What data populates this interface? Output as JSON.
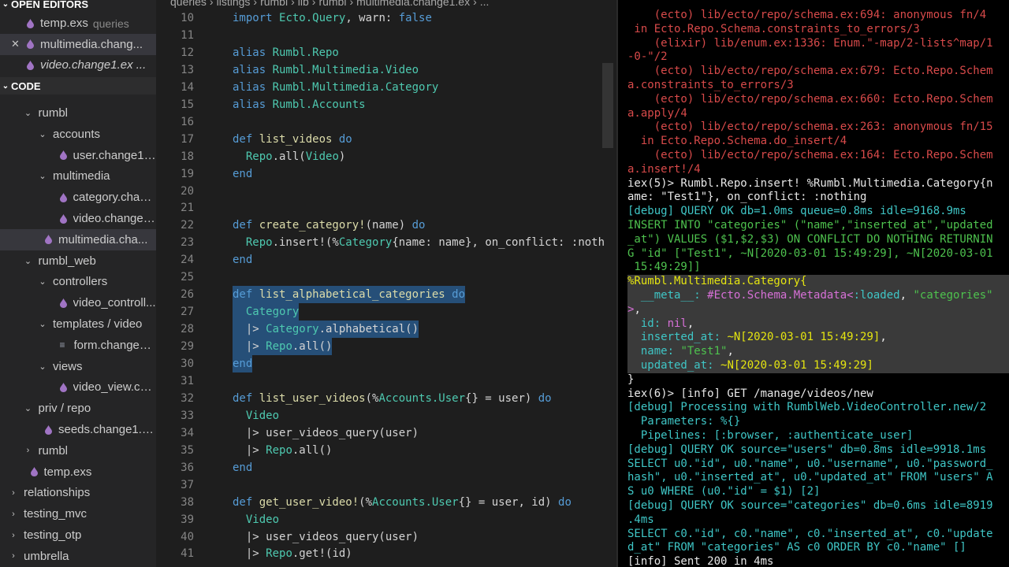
{
  "sidebar": {
    "open_editors_title": "OPEN EDITORS",
    "code_title": "CODE",
    "open_editors": [
      {
        "label": "temp.exs",
        "extra": "queries",
        "italic": false,
        "active": false,
        "closable": false
      },
      {
        "label": "multimedia.chang...",
        "extra": "",
        "italic": false,
        "active": true,
        "closable": true
      },
      {
        "label": "video.change1.ex ...",
        "extra": "",
        "italic": true,
        "active": false,
        "closable": false
      }
    ],
    "tree": [
      {
        "label": "rumbl",
        "type": "folder",
        "indent": 1,
        "open": true
      },
      {
        "label": "accounts",
        "type": "folder",
        "indent": 2,
        "open": true
      },
      {
        "label": "user.change1.ex",
        "type": "file",
        "indent": 3
      },
      {
        "label": "multimedia",
        "type": "folder",
        "indent": 2,
        "open": true
      },
      {
        "label": "category.chan...",
        "type": "file",
        "indent": 3
      },
      {
        "label": "video.change1...",
        "type": "file",
        "indent": 3
      },
      {
        "label": "multimedia.cha...",
        "type": "file",
        "indent": 2,
        "active": true
      },
      {
        "label": "rumbl_web",
        "type": "folder",
        "indent": 1,
        "open": true
      },
      {
        "label": "controllers",
        "type": "folder",
        "indent": 2,
        "open": true
      },
      {
        "label": "video_controll...",
        "type": "file",
        "indent": 3
      },
      {
        "label": "templates / video",
        "type": "folder",
        "indent": 2,
        "open": true
      },
      {
        "label": "form.change1....",
        "type": "plain",
        "indent": 3
      },
      {
        "label": "views",
        "type": "folder",
        "indent": 2,
        "open": true
      },
      {
        "label": "video_view.cha...",
        "type": "file",
        "indent": 3
      },
      {
        "label": "priv / repo",
        "type": "folder",
        "indent": 1,
        "open": true
      },
      {
        "label": "seeds.change1.exs",
        "type": "file",
        "indent": 2
      },
      {
        "label": "rumbl",
        "type": "folder",
        "indent": 1,
        "open": false
      },
      {
        "label": "temp.exs",
        "type": "file",
        "indent": 1
      },
      {
        "label": "relationships",
        "type": "folder",
        "indent": 0,
        "open": false
      },
      {
        "label": "testing_mvc",
        "type": "folder",
        "indent": 0,
        "open": false
      },
      {
        "label": "testing_otp",
        "type": "folder",
        "indent": 0,
        "open": false
      },
      {
        "label": "umbrella",
        "type": "folder",
        "indent": 0,
        "open": false
      }
    ]
  },
  "breadcrumb": [
    "queries",
    "›",
    "listings",
    "›",
    "rumbl",
    "›",
    "lib",
    "›",
    "rumbl",
    "›",
    "multimedia.change1.ex",
    "›",
    "..."
  ],
  "editor": {
    "lines": [
      {
        "n": "10",
        "tokens": [
          [
            "k",
            "import "
          ],
          [
            "t",
            "Ecto.Query"
          ],
          [
            "p",
            ", warn: "
          ],
          [
            "k",
            "false"
          ]
        ]
      },
      {
        "n": "11",
        "tokens": []
      },
      {
        "n": "12",
        "tokens": [
          [
            "k",
            "alias "
          ],
          [
            "t",
            "Rumbl.Repo"
          ]
        ]
      },
      {
        "n": "13",
        "tokens": [
          [
            "k",
            "alias "
          ],
          [
            "t",
            "Rumbl.Multimedia.Video"
          ]
        ]
      },
      {
        "n": "14",
        "tokens": [
          [
            "k",
            "alias "
          ],
          [
            "t",
            "Rumbl.Multimedia.Category"
          ]
        ]
      },
      {
        "n": "15",
        "tokens": [
          [
            "k",
            "alias "
          ],
          [
            "t",
            "Rumbl.Accounts"
          ]
        ]
      },
      {
        "n": "16",
        "tokens": []
      },
      {
        "n": "17",
        "tokens": [
          [
            "k",
            "def "
          ],
          [
            "f",
            "list_videos "
          ],
          [
            "k",
            "do"
          ]
        ]
      },
      {
        "n": "18",
        "tokens": [
          [
            "p",
            "  "
          ],
          [
            "t",
            "Repo"
          ],
          [
            "p",
            ".all("
          ],
          [
            "t",
            "Video"
          ],
          [
            "p",
            ")"
          ]
        ]
      },
      {
        "n": "19",
        "tokens": [
          [
            "k",
            "end"
          ]
        ]
      },
      {
        "n": "20",
        "tokens": []
      },
      {
        "n": "21",
        "tokens": []
      },
      {
        "n": "22",
        "tokens": [
          [
            "k",
            "def "
          ],
          [
            "f",
            "create_category!"
          ],
          [
            "p",
            "(name) "
          ],
          [
            "k",
            "do"
          ]
        ]
      },
      {
        "n": "23",
        "tokens": [
          [
            "p",
            "  "
          ],
          [
            "t",
            "Repo"
          ],
          [
            "p",
            ".insert!(%"
          ],
          [
            "t",
            "Category"
          ],
          [
            "p",
            "{name: name}, on_conflict: :noth"
          ]
        ]
      },
      {
        "n": "24",
        "tokens": [
          [
            "k",
            "end"
          ]
        ]
      },
      {
        "n": "25",
        "tokens": []
      },
      {
        "n": "26",
        "sel": true,
        "tokens": [
          [
            "k",
            "def "
          ],
          [
            "f",
            "list_alphabetical_categories "
          ],
          [
            "k",
            "do"
          ]
        ]
      },
      {
        "n": "27",
        "sel": true,
        "tokens": [
          [
            "p",
            "  "
          ],
          [
            "t",
            "Category"
          ]
        ]
      },
      {
        "n": "28",
        "sel": true,
        "tokens": [
          [
            "p",
            "  |> "
          ],
          [
            "t",
            "Category"
          ],
          [
            "p",
            ".alphabetical()"
          ]
        ]
      },
      {
        "n": "29",
        "sel": true,
        "tokens": [
          [
            "p",
            "  |> "
          ],
          [
            "t",
            "Repo"
          ],
          [
            "p",
            ".all()"
          ]
        ]
      },
      {
        "n": "30",
        "sel": true,
        "tokens": [
          [
            "k",
            "end"
          ]
        ]
      },
      {
        "n": "31",
        "tokens": []
      },
      {
        "n": "32",
        "tokens": [
          [
            "k",
            "def "
          ],
          [
            "f",
            "list_user_videos"
          ],
          [
            "p",
            "(%"
          ],
          [
            "t",
            "Accounts.User"
          ],
          [
            "p",
            "{} = user) "
          ],
          [
            "k",
            "do"
          ]
        ]
      },
      {
        "n": "33",
        "tokens": [
          [
            "p",
            "  "
          ],
          [
            "t",
            "Video"
          ]
        ]
      },
      {
        "n": "34",
        "tokens": [
          [
            "p",
            "  |> user_videos_query(user)"
          ]
        ]
      },
      {
        "n": "35",
        "tokens": [
          [
            "p",
            "  |> "
          ],
          [
            "t",
            "Repo"
          ],
          [
            "p",
            ".all()"
          ]
        ]
      },
      {
        "n": "36",
        "tokens": [
          [
            "k",
            "end"
          ]
        ]
      },
      {
        "n": "37",
        "tokens": []
      },
      {
        "n": "38",
        "tokens": [
          [
            "k",
            "def "
          ],
          [
            "f",
            "get_user_video!"
          ],
          [
            "p",
            "(%"
          ],
          [
            "t",
            "Accounts.User"
          ],
          [
            "p",
            "{} = user, id) "
          ],
          [
            "k",
            "do"
          ]
        ]
      },
      {
        "n": "39",
        "tokens": [
          [
            "p",
            "  "
          ],
          [
            "t",
            "Video"
          ]
        ]
      },
      {
        "n": "40",
        "tokens": [
          [
            "p",
            "  |> user_videos_query(user)"
          ]
        ]
      },
      {
        "n": "41",
        "tokens": [
          [
            "p",
            "  |> "
          ],
          [
            "t",
            "Repo"
          ],
          [
            "p",
            ".get!(id)"
          ]
        ]
      }
    ]
  },
  "terminal": {
    "lines": [
      {
        "sel": false,
        "tokens": [
          [
            "red",
            "    (ecto) lib/ecto/repo/schema.ex:694: anonymous fn/4"
          ]
        ]
      },
      {
        "sel": false,
        "tokens": [
          [
            "red",
            " in Ecto.Repo.Schema.constraints_to_errors/3"
          ]
        ]
      },
      {
        "sel": false,
        "tokens": [
          [
            "red",
            "    (elixir) lib/enum.ex:1336: Enum.\"-map/2-lists^map/1"
          ]
        ]
      },
      {
        "sel": false,
        "tokens": [
          [
            "red",
            "-0-\"/2"
          ]
        ]
      },
      {
        "sel": false,
        "tokens": [
          [
            "red",
            "    (ecto) lib/ecto/repo/schema.ex:679: Ecto.Repo.Schem"
          ]
        ]
      },
      {
        "sel": false,
        "tokens": [
          [
            "red",
            "a.constraints_to_errors/3"
          ]
        ]
      },
      {
        "sel": false,
        "tokens": [
          [
            "red",
            "    (ecto) lib/ecto/repo/schema.ex:660: Ecto.Repo.Schem"
          ]
        ]
      },
      {
        "sel": false,
        "tokens": [
          [
            "red",
            "a.apply/4"
          ]
        ]
      },
      {
        "sel": false,
        "tokens": [
          [
            "red",
            "    (ecto) lib/ecto/repo/schema.ex:263: anonymous fn/15"
          ]
        ]
      },
      {
        "sel": false,
        "tokens": [
          [
            "red",
            "  in Ecto.Repo.Schema.do_insert/4"
          ]
        ]
      },
      {
        "sel": false,
        "tokens": [
          [
            "red",
            "    (ecto) lib/ecto/repo/schema.ex:164: Ecto.Repo.Schem"
          ]
        ]
      },
      {
        "sel": false,
        "tokens": [
          [
            "red",
            "a.insert!/4"
          ]
        ]
      },
      {
        "sel": false,
        "tokens": [
          [
            "white",
            "iex(5)> Rumbl.Repo.insert! %Rumbl.Multimedia.Category{n"
          ]
        ]
      },
      {
        "sel": false,
        "tokens": [
          [
            "white",
            "ame: \"Test1\"}, on_conflict: :nothing"
          ]
        ]
      },
      {
        "sel": false,
        "tokens": [
          [
            "cyan",
            "[debug] QUERY OK db=1.0ms queue=0.8ms idle=9168.9ms"
          ]
        ]
      },
      {
        "sel": false,
        "tokens": [
          [
            "green",
            "INSERT INTO \"categories\" (\"name\",\"inserted_at\",\"updated"
          ]
        ]
      },
      {
        "sel": false,
        "tokens": [
          [
            "green",
            "_at\") VALUES ($1,$2,$3) ON CONFLICT DO NOTHING RETURNIN"
          ]
        ]
      },
      {
        "sel": false,
        "tokens": [
          [
            "green",
            "G \"id\" [\"Test1\", ~N[2020-03-01 15:49:29], ~N[2020-03-01"
          ]
        ]
      },
      {
        "sel": false,
        "tokens": [
          [
            "green",
            " 15:49:29]]"
          ]
        ]
      },
      {
        "sel": true,
        "tokens": [
          [
            "yellow",
            "%Rumbl.Multimedia.Category{"
          ]
        ]
      },
      {
        "sel": true,
        "tokens": [
          [
            "cyan",
            "  __meta__: "
          ],
          [
            "magenta",
            "#Ecto.Schema.Metadata<"
          ],
          [
            "cyan",
            ":loaded"
          ],
          [
            "white",
            ", "
          ],
          [
            "green",
            "\"categories\""
          ]
        ]
      },
      {
        "sel": true,
        "tokens": [
          [
            "magenta",
            ">"
          ],
          [
            "white",
            ","
          ]
        ]
      },
      {
        "sel": true,
        "tokens": [
          [
            "cyan",
            "  id: "
          ],
          [
            "magenta",
            "nil"
          ],
          [
            "white",
            ","
          ]
        ]
      },
      {
        "sel": true,
        "tokens": [
          [
            "cyan",
            "  inserted_at: "
          ],
          [
            "yellow",
            "~N[2020-03-01 15:49:29]"
          ],
          [
            "white",
            ","
          ]
        ]
      },
      {
        "sel": true,
        "tokens": [
          [
            "cyan",
            "  name: "
          ],
          [
            "green",
            "\"Test1\""
          ],
          [
            "white",
            ","
          ]
        ]
      },
      {
        "sel": true,
        "tokens": [
          [
            "cyan",
            "  updated_at: "
          ],
          [
            "yellow",
            "~N[2020-03-01 15:49:29]"
          ]
        ]
      },
      {
        "sel": false,
        "tokens": [
          [
            "white",
            "}"
          ]
        ]
      },
      {
        "sel": false,
        "tokens": [
          [
            "white",
            "iex(6)> [info] GET /manage/videos/new"
          ]
        ]
      },
      {
        "sel": false,
        "tokens": [
          [
            "cyan",
            "[debug] Processing with RumblWeb.VideoController.new/2"
          ]
        ]
      },
      {
        "sel": false,
        "tokens": [
          [
            "cyan",
            "  Parameters: %{}"
          ]
        ]
      },
      {
        "sel": false,
        "tokens": [
          [
            "cyan",
            "  Pipelines: [:browser, :authenticate_user]"
          ]
        ]
      },
      {
        "sel": false,
        "tokens": [
          [
            "cyan",
            "[debug] QUERY OK source=\"users\" db=0.8ms idle=9918.1ms"
          ]
        ]
      },
      {
        "sel": false,
        "tokens": [
          [
            "cyan",
            "SELECT u0.\"id\", u0.\"name\", u0.\"username\", u0.\"password_"
          ]
        ]
      },
      {
        "sel": false,
        "tokens": [
          [
            "cyan",
            "hash\", u0.\"inserted_at\", u0.\"updated_at\" FROM \"users\" A"
          ]
        ]
      },
      {
        "sel": false,
        "tokens": [
          [
            "cyan",
            "S u0 WHERE (u0.\"id\" = $1) [2]"
          ]
        ]
      },
      {
        "sel": false,
        "tokens": [
          [
            "cyan",
            "[debug] QUERY OK source=\"categories\" db=0.6ms idle=8919"
          ]
        ]
      },
      {
        "sel": false,
        "tokens": [
          [
            "cyan",
            ".4ms"
          ]
        ]
      },
      {
        "sel": false,
        "tokens": [
          [
            "cyan",
            "SELECT c0.\"id\", c0.\"name\", c0.\"inserted_at\", c0.\"update"
          ]
        ]
      },
      {
        "sel": false,
        "tokens": [
          [
            "cyan",
            "d_at\" FROM \"categories\" AS c0 ORDER BY c0.\"name\" []"
          ]
        ]
      },
      {
        "sel": false,
        "tokens": [
          [
            "white",
            "[info] Sent 200 in 4ms"
          ]
        ]
      }
    ]
  },
  "colors": {
    "elixir_drop": "#a074c4",
    "selection": "#264f78",
    "sidebar_bg": "#252526",
    "editor_bg": "#1e1e1e",
    "terminal_bg": "#000000"
  }
}
